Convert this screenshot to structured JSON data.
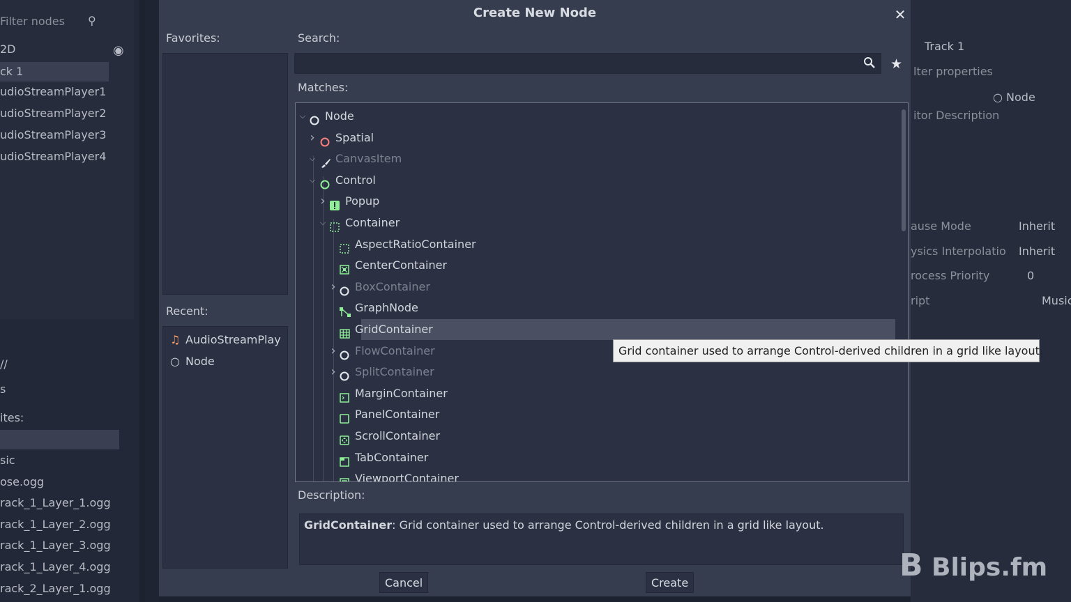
{
  "background": {
    "scene_filter_placeholder": "Filter nodes",
    "scene_nodes": [
      "2D",
      "ck 1",
      "udioStreamPlayer1",
      "udioStreamPlayer2",
      "udioStreamPlayer3",
      "udioStreamPlayer4"
    ],
    "fs_path": "//",
    "fs_filter": "s",
    "fs_favorites": "ites:",
    "fs_files": [
      "sic",
      "ose.ogg",
      "rack_1_Layer_1.ogg",
      "rack_1_Layer_2.ogg",
      "rack_1_Layer_3.ogg",
      "rack_1_Layer_4.ogg",
      "rack_2_Layer_1.ogg"
    ],
    "inspector": {
      "object": "Track 1",
      "filter": "lter properties",
      "node_label": "Node",
      "editor_description": "itor Description",
      "props": [
        {
          "name": "ause Mode",
          "value": "Inherit"
        },
        {
          "name": "ysics Interpolatio",
          "value": "Inherit"
        },
        {
          "name": "rocess Priority",
          "value": "0"
        },
        {
          "name": "ript",
          "value": "Music"
        }
      ]
    }
  },
  "dialog": {
    "title": "Create New Node",
    "favorites_label": "Favorites:",
    "recent_label": "Recent:",
    "recent": [
      {
        "label": "AudioStreamPlay",
        "icon": "audio-stream-icon"
      },
      {
        "label": "Node",
        "icon": "node-circle-icon"
      }
    ],
    "search_label": "Search:",
    "search_value": "",
    "matches_label": "Matches:",
    "tree": [
      {
        "label": "Node",
        "depth": 0,
        "arrow": "down",
        "icon": "node-circle-icon",
        "gray": false
      },
      {
        "label": "Spatial",
        "depth": 1,
        "arrow": "right",
        "icon": "spatial-circle-icon",
        "gray": false
      },
      {
        "label": "CanvasItem",
        "depth": 1,
        "arrow": "down",
        "icon": "brush-icon",
        "gray": true
      },
      {
        "label": "Control",
        "depth": 2,
        "arrow": "down",
        "icon": "control-circle-icon",
        "gray": false
      },
      {
        "label": "Popup",
        "depth": 3,
        "arrow": "right",
        "icon": "popup-icon",
        "gray": false
      },
      {
        "label": "Container",
        "depth": 3,
        "arrow": "down",
        "icon": "container-icon",
        "gray": false
      },
      {
        "label": "AspectRatioContainer",
        "depth": 4,
        "arrow": "",
        "icon": "aspect-ratio-icon",
        "gray": false
      },
      {
        "label": "CenterContainer",
        "depth": 4,
        "arrow": "",
        "icon": "center-container-icon",
        "gray": false
      },
      {
        "label": "BoxContainer",
        "depth": 4,
        "arrow": "right",
        "icon": "box-circle-icon",
        "gray": true
      },
      {
        "label": "GraphNode",
        "depth": 4,
        "arrow": "",
        "icon": "graph-node-icon",
        "gray": false
      },
      {
        "label": "GridContainer",
        "depth": 4,
        "arrow": "",
        "icon": "grid-container-icon",
        "gray": false
      },
      {
        "label": "FlowContainer",
        "depth": 4,
        "arrow": "right",
        "icon": "flow-circle-icon",
        "gray": true
      },
      {
        "label": "SplitContainer",
        "depth": 4,
        "arrow": "right",
        "icon": "split-circle-icon",
        "gray": true
      },
      {
        "label": "MarginContainer",
        "depth": 4,
        "arrow": "",
        "icon": "margin-container-icon",
        "gray": false
      },
      {
        "label": "PanelContainer",
        "depth": 4,
        "arrow": "",
        "icon": "panel-container-icon",
        "gray": false
      },
      {
        "label": "ScrollContainer",
        "depth": 4,
        "arrow": "",
        "icon": "scroll-container-icon",
        "gray": false
      },
      {
        "label": "TabContainer",
        "depth": 4,
        "arrow": "",
        "icon": "tab-container-icon",
        "gray": false
      },
      {
        "label": "ViewportContainer",
        "depth": 4,
        "arrow": "",
        "icon": "viewport-container-icon",
        "gray": false
      }
    ],
    "selected": "GridContainer",
    "tooltip": "Grid container used to arrange Control-derived children in a grid like layout.",
    "description_label": "Description:",
    "description_name": "GridContainer",
    "description_text": ": Grid container used to arrange Control-derived children in a grid like layout.",
    "cancel_label": "Cancel",
    "create_label": "Create"
  },
  "watermark": "Blips.fm",
  "colors": {
    "node": "#e6e8ed",
    "spatial": "#fc7f7f",
    "control": "#8eef97",
    "accent": "#4a5062"
  }
}
